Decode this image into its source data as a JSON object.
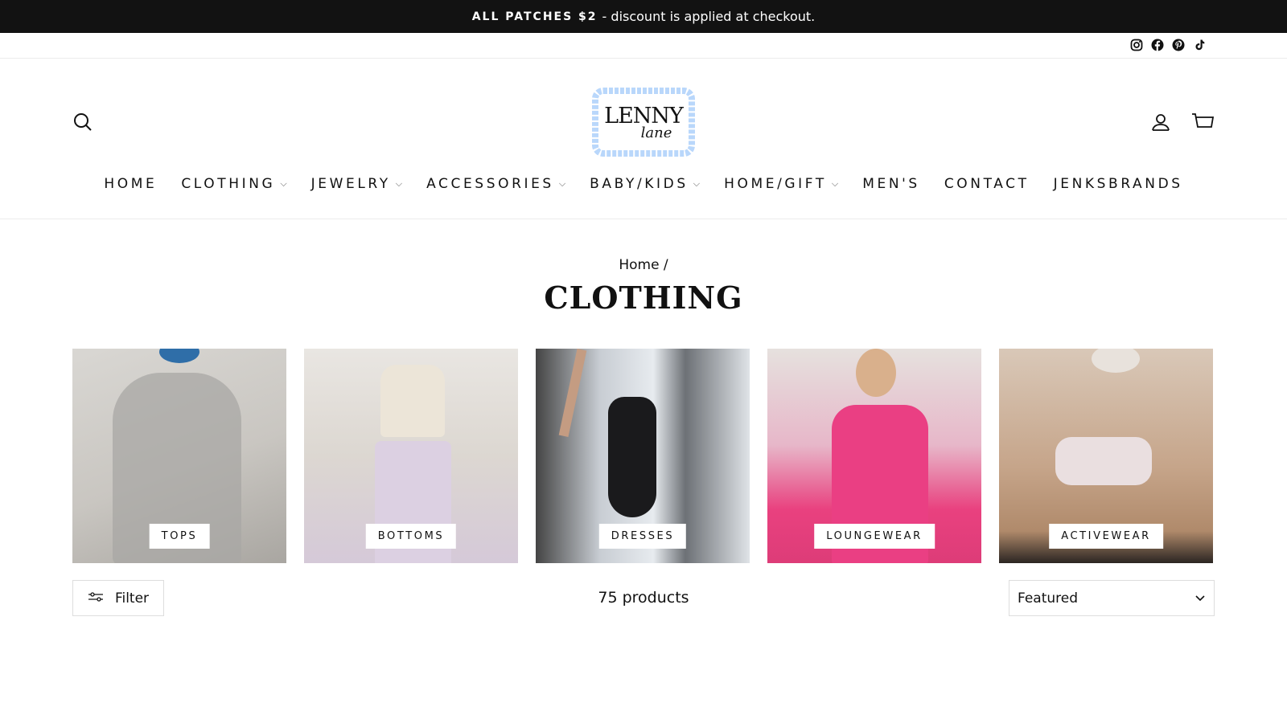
{
  "announcement": {
    "bold": "ALL PATCHES $2",
    "rest": "- discount is applied at checkout."
  },
  "social_icons": [
    "instagram-icon",
    "facebook-icon",
    "pinterest-icon",
    "tiktok-icon"
  ],
  "logo": {
    "line1": "LENNY",
    "line2": "lane",
    "border_color": "#b9d7fb"
  },
  "nav": [
    {
      "label": "HOME",
      "dropdown": false
    },
    {
      "label": "CLOTHING",
      "dropdown": true
    },
    {
      "label": "JEWELRY",
      "dropdown": true
    },
    {
      "label": "ACCESSORIES",
      "dropdown": true
    },
    {
      "label": "BABY/KIDS",
      "dropdown": true
    },
    {
      "label": "HOME/GIFT",
      "dropdown": true
    },
    {
      "label": "MEN'S",
      "dropdown": false
    },
    {
      "label": "CONTACT",
      "dropdown": false
    },
    {
      "label": "JENKSBRANDS",
      "dropdown": false
    }
  ],
  "breadcrumb": "Home /",
  "page_title": "CLOTHING",
  "collections": [
    {
      "label": "TOPS"
    },
    {
      "label": "BOTTOMS"
    },
    {
      "label": "DRESSES"
    },
    {
      "label": "LOUNGEWEAR"
    },
    {
      "label": "ACTIVEWEAR"
    }
  ],
  "toolbar": {
    "filter_label": "Filter",
    "product_count": "75 products",
    "sort_selected": "Featured"
  },
  "colors": {
    "announcement_bg": "#121212",
    "text": "#111111",
    "border": "#dddddd"
  }
}
